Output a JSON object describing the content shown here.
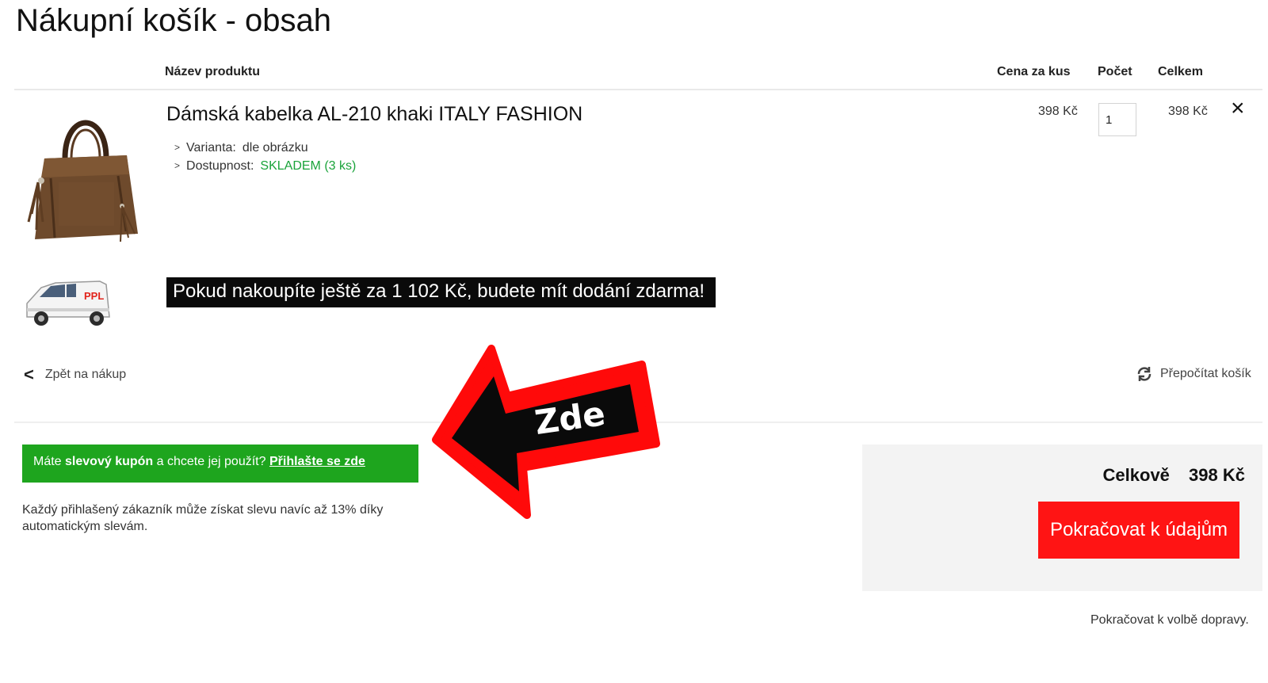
{
  "page": {
    "title": "Nákupní košík - obsah"
  },
  "table_header": {
    "name": "Název produktu",
    "price": "Cena za kus",
    "qty": "Počet",
    "total": "Celkem"
  },
  "product": {
    "name": "Dámská kabelka AL-210 khaki ITALY FASHION",
    "variant_label": "Varianta:",
    "variant_value": "dle obrázku",
    "availability_label": "Dostupnost:",
    "availability_value": "SKLADEM (3 ks)",
    "unit_price": "398 Kč",
    "quantity": "1",
    "line_total": "398 Kč",
    "remove_icon": "×"
  },
  "shipping": {
    "courier_label": "PPL",
    "banner_text": "Pokud nakoupíte ještě za 1 102 Kč, budete mít dodání zdarma!"
  },
  "nav": {
    "back_label": "Zpět na nákup",
    "recalc_label": "Přepočítat košík"
  },
  "coupon": {
    "text_start": "Máte",
    "text_bold": "slevový kupón",
    "text_mid": "a chcete jej použít?",
    "link_label": "Přihlašte se zde"
  },
  "discount_note": "Každý přihlašený zákazník může získat slevu navíc až 13% díky automatickým slevám.",
  "summary": {
    "total_label": "Celkově",
    "total_value": "398 Kč",
    "continue_label": "Pokračovat k údajům",
    "continue_note": "Pokračovat k volbě dopravy."
  },
  "annotation": {
    "arrow_text": "Zde"
  },
  "colors": {
    "accent_red": "#ff1414",
    "coupon_green": "#1ea51e",
    "stock_green": "#1aa33a",
    "banner_black": "#0a0a0a"
  }
}
